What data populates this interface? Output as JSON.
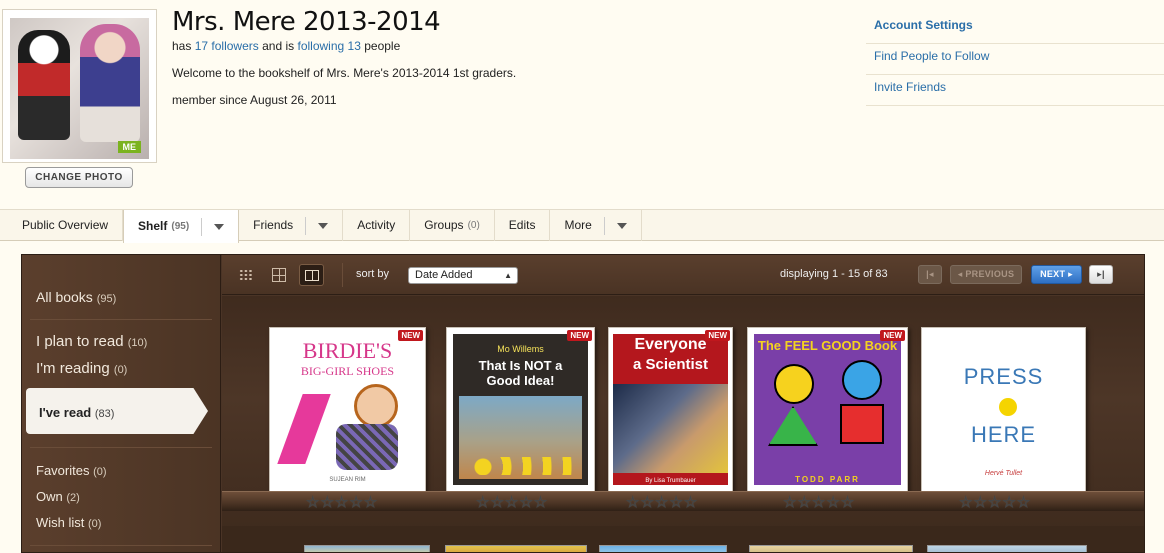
{
  "profile": {
    "title": "Mrs. Mere 2013-2014",
    "has_text": "has",
    "followers_count": "17",
    "followers_label": "followers",
    "and_following": "and is",
    "following_label": "following",
    "following_count": "13",
    "people_text": "people",
    "welcome": "Welcome to the bookshelf of Mrs. Mere's 2013-2014 1st graders.",
    "member_since": "member since August 26, 2011",
    "me_badge": "ME",
    "change_photo": "CHANGE PHOTO"
  },
  "right_links": [
    "Account Settings",
    "Find People to Follow",
    "Invite Friends"
  ],
  "tabs": [
    {
      "label": "Public Overview",
      "count": ""
    },
    {
      "label": "Shelf",
      "count": "(95)"
    },
    {
      "label": "Friends",
      "count": ""
    },
    {
      "label": "Activity",
      "count": ""
    },
    {
      "label": "Groups",
      "count": "(0)"
    },
    {
      "label": "Edits",
      "count": ""
    },
    {
      "label": "More",
      "count": ""
    }
  ],
  "sidebar": {
    "all_books": {
      "label": "All books",
      "count": "(95)"
    },
    "plan": {
      "label": "I plan to read",
      "count": "(10)"
    },
    "reading": {
      "label": "I'm reading",
      "count": "(0)"
    },
    "read": {
      "label": "I've read",
      "count": "(83)"
    },
    "favorites": {
      "label": "Favorites",
      "count": "(0)"
    },
    "own": {
      "label": "Own",
      "count": "(2)"
    },
    "wishlist": {
      "label": "Wish list",
      "count": "(0)"
    }
  },
  "toolbar": {
    "sort_label": "sort by",
    "sort_value": "Date Added",
    "displaying": "displaying 1 - 15 of 83",
    "previous": "◂ PREVIOUS",
    "next": "NEXT ▸"
  },
  "books": [
    {
      "title1": "BIRDIE'S",
      "title2": "BIG-GIRL SHOES",
      "author": "SUJEAN RIM",
      "badge": "NEW"
    },
    {
      "title1": "Mo Willems",
      "title2": "That Is NOT a Good Idea!",
      "author": "",
      "badge": "NEW"
    },
    {
      "title1": "Everyone",
      "title2": "a Scientist",
      "author": "By Lisa Trumbauer",
      "badge": "NEW"
    },
    {
      "title1": "The FEEL GOOD Book",
      "title2": "",
      "author": "TODD PARR",
      "badge": "NEW"
    },
    {
      "title1": "PRESS",
      "title2": "HERE",
      "author": "Hervé Tullet",
      "badge": ""
    }
  ],
  "stars_glyph": "☆☆☆☆☆",
  "colors": {
    "link": "#2a6ea8",
    "shelf": "#4a3426",
    "new_badge": "#c0171d",
    "next_btn": "#2e6fc3",
    "me_badge": "#7bb31f"
  }
}
